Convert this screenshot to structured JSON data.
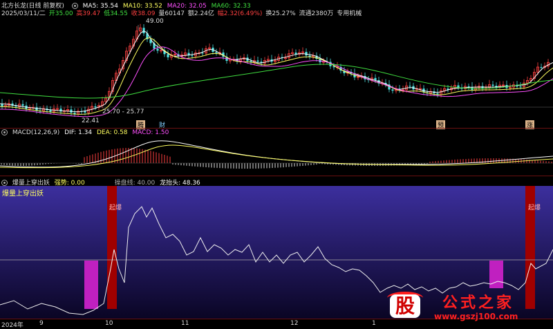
{
  "header": {
    "row1": {
      "stock": "北方长龙(日线 前复权)",
      "ma5": "MA5: 35.54",
      "ma10": "MA10: 33.52",
      "ma20": "MA20: 32.05",
      "ma60": "MA60: 32.33"
    },
    "row2": {
      "date": "2025/03/11/二",
      "open": "开35.00",
      "high": "高39.47",
      "low": "低34.55",
      "close": "收38.09",
      "vol": "量60147",
      "amount": "额2.24亿",
      "change": "幅2.32(6.49%)",
      "turnover": "换25.27%",
      "float": "流通2380万",
      "industry": "专用机械"
    }
  },
  "kline": {
    "price_high": "49.00",
    "range_label": "25.70 - 25.77",
    "price_low": "22.41",
    "markers": [
      "腾",
      "财",
      "预",
      "涨"
    ]
  },
  "macd": {
    "name": "MACD(12,26,9)",
    "dif": "DIF: 1.34",
    "dea": "DEA: 0.58",
    "macd": "MACD: 1.50"
  },
  "indicator": {
    "name": "爆量上穿出妖",
    "strength": "强势: 0.00",
    "control": "操盘线: 40.00",
    "dragon": "龙抬头: 48.36",
    "sub_title": "爆量上穿出妖",
    "signal1": "起爆",
    "signal2": "起爆"
  },
  "xaxis": {
    "labels": [
      "2024年",
      "9",
      "10",
      "11",
      "12",
      "1"
    ]
  },
  "watermark": {
    "logo": "股",
    "text": "公式之家",
    "url": "www.gszj100.com"
  },
  "colors": {
    "up": "#ff4040",
    "down": "#4ee0e0",
    "ma5": "#ffffff",
    "ma10": "#ffff60",
    "ma20": "#ff50ff",
    "ma60": "#40e040",
    "signal_red": "#a00000",
    "signal_magenta": "#c020c0"
  }
}
